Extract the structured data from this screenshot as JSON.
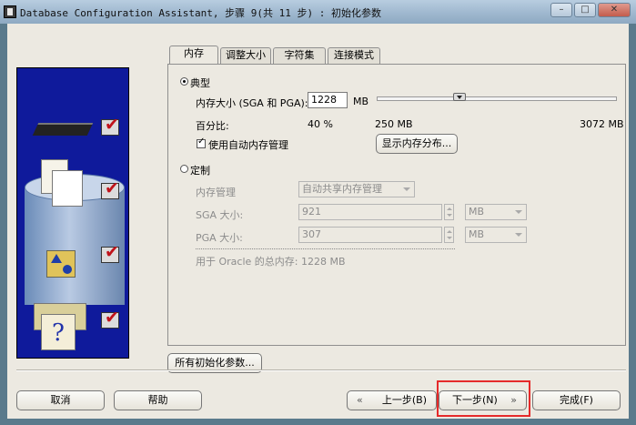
{
  "window": {
    "title": "Database Configuration Assistant, 步骤 9(共 11 步) : 初始化参数"
  },
  "tabs": [
    {
      "label": "内存",
      "active": true
    },
    {
      "label": "调整大小",
      "active": false
    },
    {
      "label": "字符集",
      "active": false
    },
    {
      "label": "连接模式",
      "active": false
    }
  ],
  "typical": {
    "radio_label": "典型",
    "memory_size_label": "内存大小 (SGA 和 PGA):",
    "memory_size_value": "1228",
    "memory_unit": "MB",
    "percent_label": "百分比:",
    "percent_value": "40 %",
    "slider_min_label": "250 MB",
    "slider_max_label": "3072 MB",
    "slider_min_mb": 250,
    "slider_max_mb": 3072,
    "slider_value_mb": 1228,
    "auto_memory_label": "使用自动内存管理",
    "auto_memory_checked": true,
    "show_distribution_button": "显示内存分布..."
  },
  "custom": {
    "radio_label": "定制",
    "memory_mgmt_label": "内存管理",
    "memory_mgmt_value": "自动共享内存管理",
    "sga_label": "SGA 大小:",
    "sga_value": "921",
    "sga_unit": "MB",
    "pga_label": "PGA 大小:",
    "pga_value": "307",
    "pga_unit": "MB",
    "total_label": "用于 Oracle 的总内存: 1228 MB"
  },
  "all_params_button": "所有初始化参数...",
  "footer": {
    "cancel": "取消",
    "help": "帮助",
    "back": "上一步(B)",
    "next": "下一步(N)",
    "finish": "完成(F)"
  },
  "colors": {
    "graphic_bg": "#0f1a9b",
    "highlight": "#e52a2a",
    "window_bg": "#ece9e1"
  }
}
